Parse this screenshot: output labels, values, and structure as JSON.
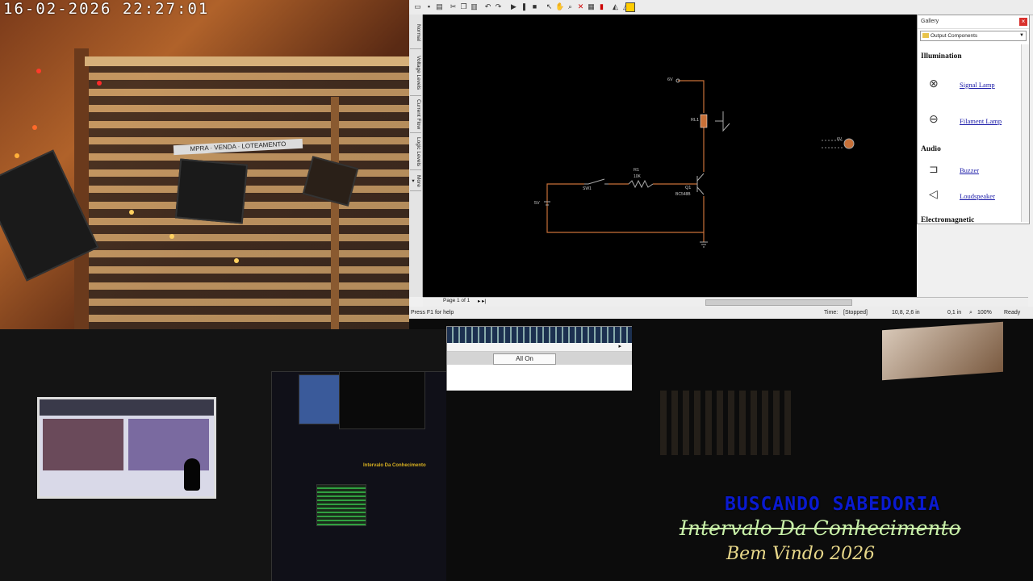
{
  "camera": {
    "timestamp": "16-02-2026  22:27:01",
    "store_sign": "MPRA · VENDA · LOTEAMENTO"
  },
  "circuit_app": {
    "side_tabs": [
      "Normal",
      "Voltage Levels",
      "Current Flow",
      "Logic Levels",
      "More ▾"
    ],
    "canvas_labels": {
      "v6": "6V",
      "rl1": "RL1",
      "r1": "R1",
      "r1_value": "10K",
      "sw1": "SW1",
      "q1": "Q1",
      "q1_model": "BC548B",
      "v5": "5V",
      "lamp_label": "6V"
    },
    "gallery": {
      "title": "Gallery",
      "close": "×",
      "category": "Output Components",
      "sections": [
        {
          "heading": "Illumination",
          "items": [
            "Signal Lamp",
            "Filament Lamp"
          ]
        },
        {
          "heading": "Audio",
          "items": [
            "Buzzer",
            "Loudspeaker"
          ]
        },
        {
          "heading": "Electromagnetic",
          "items": []
        }
      ]
    },
    "page_nav": "Page 1 of 1",
    "status": {
      "help": "Press F1 for help",
      "time_label": "Time:",
      "time_value": "[Stopped]",
      "coords": "10,8, 2,6 in",
      "step": "0,1 in",
      "zoom": "100%",
      "state": "Ready"
    }
  },
  "mini_window": {
    "button": "All On"
  },
  "overlay": {
    "line1": "BUSCANDO SABEDORIA",
    "line2": "Intervalo Da Conhecimento",
    "line3": "Bem Vindo 2026"
  },
  "monitor_banner": "Intervalo Da Conhecimento",
  "colors": {
    "wire": "#c87038",
    "line1": "#0a1ad0",
    "line2": "#c8f0a8",
    "line3": "#e8d88a"
  }
}
